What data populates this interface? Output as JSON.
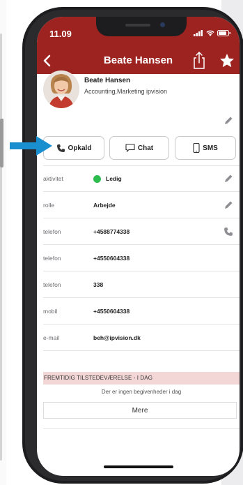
{
  "status_bar": {
    "time": "11.09"
  },
  "nav": {
    "title": "Beate Hansen"
  },
  "profile": {
    "name": "Beate Hansen",
    "department": "Accounting,Marketing ipvision"
  },
  "actions": {
    "call_label": "Opkald",
    "chat_label": "Chat",
    "sms_label": "SMS"
  },
  "rows": [
    {
      "label": "aktivitet",
      "value": "Ledig"
    },
    {
      "label": "rolle",
      "value": "Arbejde"
    },
    {
      "label": "telefon",
      "value": "+4588774338"
    },
    {
      "label": "telefon",
      "value": "+4550604338"
    },
    {
      "label": "telefon",
      "value": "338"
    },
    {
      "label": "mobil",
      "value": "+4550604338"
    },
    {
      "label": "e-mail",
      "value": "beh@ipvision.dk"
    }
  ],
  "future": {
    "header": "FREMTIDIG TILSTEDEVÆRELSE - I DAG",
    "empty_text": "Der er ingen begivenheder i dag",
    "more_label": "Mere"
  },
  "colors": {
    "brand": "#9d2321",
    "status_available": "#2dbd4e",
    "pointer": "#1a8fd0",
    "section_bg": "#f3d6d6"
  },
  "icons": [
    "back-icon",
    "share-icon",
    "star-icon",
    "phone-icon",
    "chat-icon",
    "mobile-icon",
    "pencil-icon",
    "signal-icon",
    "wifi-icon",
    "battery-icon",
    "arrow-right-icon"
  ]
}
